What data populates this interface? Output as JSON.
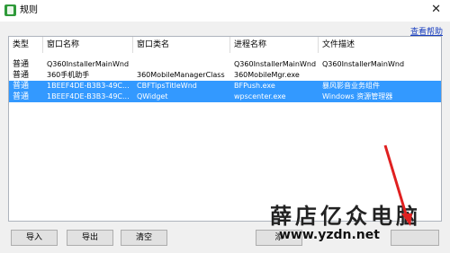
{
  "window": {
    "title": "规则",
    "close_icon": "close-icon"
  },
  "help_link": "查看帮助",
  "table": {
    "columns": [
      "类型",
      "窗口名称",
      "窗口类名",
      "进程名称",
      "文件描述"
    ],
    "rows": [
      {
        "type": "普通",
        "window_name": "Q360InstallerMainWnd",
        "class_name": "",
        "process": "Q360InstallerMainWnd",
        "desc": "Q360InstallerMainWnd",
        "selected": false
      },
      {
        "type": "普通",
        "window_name": "360手机助手",
        "class_name": "360MobileManagerClass",
        "process": "360MobileMgr.exe",
        "desc": "",
        "selected": false
      },
      {
        "type": "普通",
        "window_name": "1BEEF4DE-B3B3-49C...",
        "class_name": "CBFTipsTitleWnd",
        "process": "BFPush.exe",
        "desc": "暴风影音业务组件",
        "selected": true
      },
      {
        "type": "普通",
        "window_name": "1BEEF4DE-B3B3-49C...",
        "class_name": "QWidget",
        "process": "wpscenter.exe",
        "desc": "Windows 资源管理器",
        "selected": true
      }
    ]
  },
  "buttons": {
    "import": "导入",
    "export": "导出",
    "clear": "清空",
    "add": "添"
  },
  "watermark": {
    "text": "薛店亿众电脑",
    "url": "www.yzdn.net"
  },
  "colors": {
    "selection": "#3399ff",
    "arrow": "#e02020"
  }
}
